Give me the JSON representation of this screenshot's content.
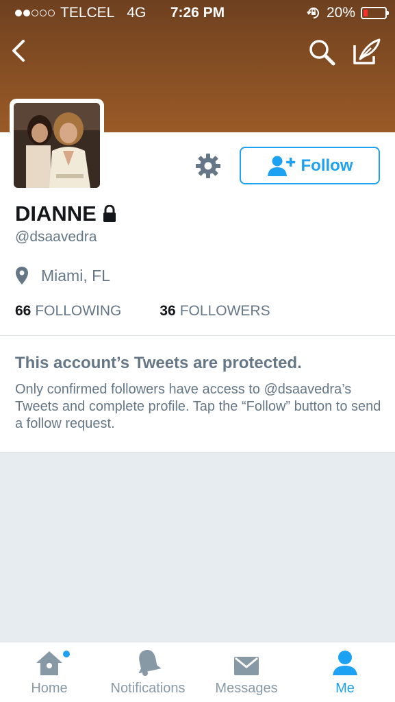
{
  "status_bar": {
    "carrier": "TELCEL",
    "network": "4G",
    "time": "7:26 PM",
    "battery": "20%",
    "battery_level": 0.2,
    "signal_bars": 2
  },
  "nav": {
    "back_icon": "chevron-left-icon",
    "search_icon": "search-icon",
    "compose_icon": "compose-tweet-icon"
  },
  "profile": {
    "name": "DIANNE",
    "handle": "@dsaavedra",
    "location": "Miami, FL",
    "following_count": "66",
    "following_label": "FOLLOWING",
    "followers_count": "36",
    "followers_label": "FOLLOWERS",
    "follow_label": "Follow"
  },
  "protected": {
    "title": "This account’s Tweets are protected.",
    "body": "Only confirmed followers have access to @dsaavedra’s Tweets and complete profile. Tap the “Follow” button to send a follow request."
  },
  "tabs": [
    {
      "label": "Home",
      "icon": "home-icon",
      "active": false,
      "badge": true
    },
    {
      "label": "Notifications",
      "icon": "bell-icon",
      "active": false,
      "badge": false
    },
    {
      "label": "Messages",
      "icon": "envelope-icon",
      "active": false,
      "badge": false
    },
    {
      "label": "Me",
      "icon": "person-icon",
      "active": true,
      "badge": false
    }
  ],
  "colors": {
    "accent": "#1da1f2",
    "header_brown": "#8a5024",
    "muted_text": "#657786",
    "tab_inactive": "#8899a6"
  }
}
